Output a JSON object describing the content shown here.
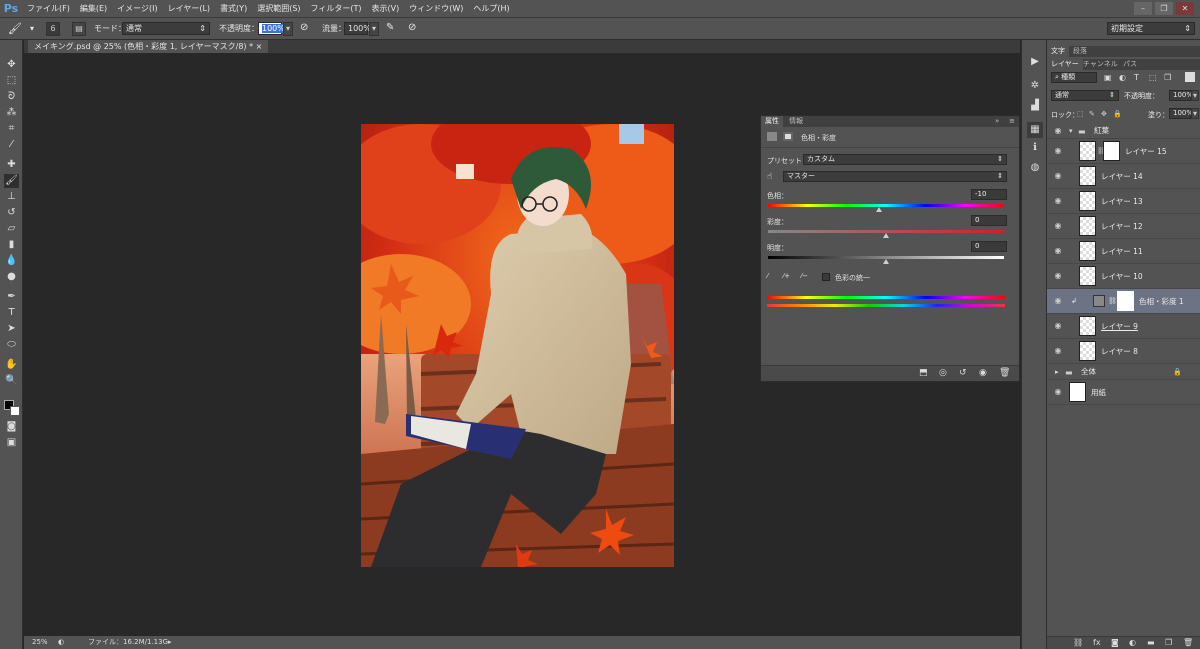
{
  "app": {
    "logo": "Ps"
  },
  "menu": [
    "ファイル(F)",
    "編集(E)",
    "イメージ(I)",
    "レイヤー(L)",
    "書式(Y)",
    "選択範囲(S)",
    "フィルター(T)",
    "表示(V)",
    "ウィンドウ(W)",
    "ヘルプ(H)"
  ],
  "window_controls": {
    "minimize": "–",
    "restore": "❐",
    "close": "✕"
  },
  "options": {
    "brush_size": "6",
    "mode_label": "モード：",
    "mode_value": "通常",
    "opacity_label": "不透明度：",
    "opacity_value": "100%",
    "flow_label": "流量：",
    "flow_value": "100%",
    "workspace": "初期設定"
  },
  "document": {
    "tab_title": "メイキング.psd @ 25% (色相・彩度 1, レイヤーマスク/8) *",
    "close": "×"
  },
  "status": {
    "zoom": "25%",
    "file_info": "ファイル：16.2M/1.13G"
  },
  "properties": {
    "tabs": [
      "属性",
      "情報"
    ],
    "title": "色相・彩度",
    "preset_label": "プリセット：",
    "preset_value": "カスタム",
    "channel_value": "マスター",
    "hue_label": "色相：",
    "hue_value": "-10",
    "saturation_label": "彩度：",
    "saturation_value": "0",
    "lightness_label": "明度：",
    "lightness_value": "0",
    "colorize_label": "色彩の統一",
    "hue_fraction": 0.472,
    "saturation_fraction": 0.5,
    "lightness_fraction": 0.5
  },
  "right_panel": {
    "top_tabs": [
      "文字",
      "段落"
    ],
    "layer_tabs": [
      "レイヤー",
      "チャンネル",
      "パス"
    ],
    "filter_kind": "種類",
    "blend_mode": "通常",
    "opacity_label": "不透明度：",
    "opacity_value": "100%",
    "lock_label": "ロック：",
    "fill_label": "塗り：",
    "fill_value": "100%"
  },
  "layers": [
    {
      "name": "紅葉",
      "type": "group"
    },
    {
      "name": "レイヤー 15",
      "type": "masked"
    },
    {
      "name": "レイヤー 14",
      "type": "layer"
    },
    {
      "name": "レイヤー 13",
      "type": "layer"
    },
    {
      "name": "レイヤー 12",
      "type": "layer"
    },
    {
      "name": "レイヤー 11",
      "type": "layer"
    },
    {
      "name": "レイヤー 10",
      "type": "layer"
    },
    {
      "name": "色相・彩度 1",
      "type": "adjustment"
    },
    {
      "name": "レイヤー 9",
      "type": "layer"
    },
    {
      "name": "レイヤー 8",
      "type": "layer"
    },
    {
      "name": "全体",
      "type": "group-collapsed"
    },
    {
      "name": "用紙",
      "type": "paper"
    }
  ],
  "colors": {
    "accent": "#5fa8e6",
    "panel": "#535353",
    "canvas": "#282828"
  }
}
